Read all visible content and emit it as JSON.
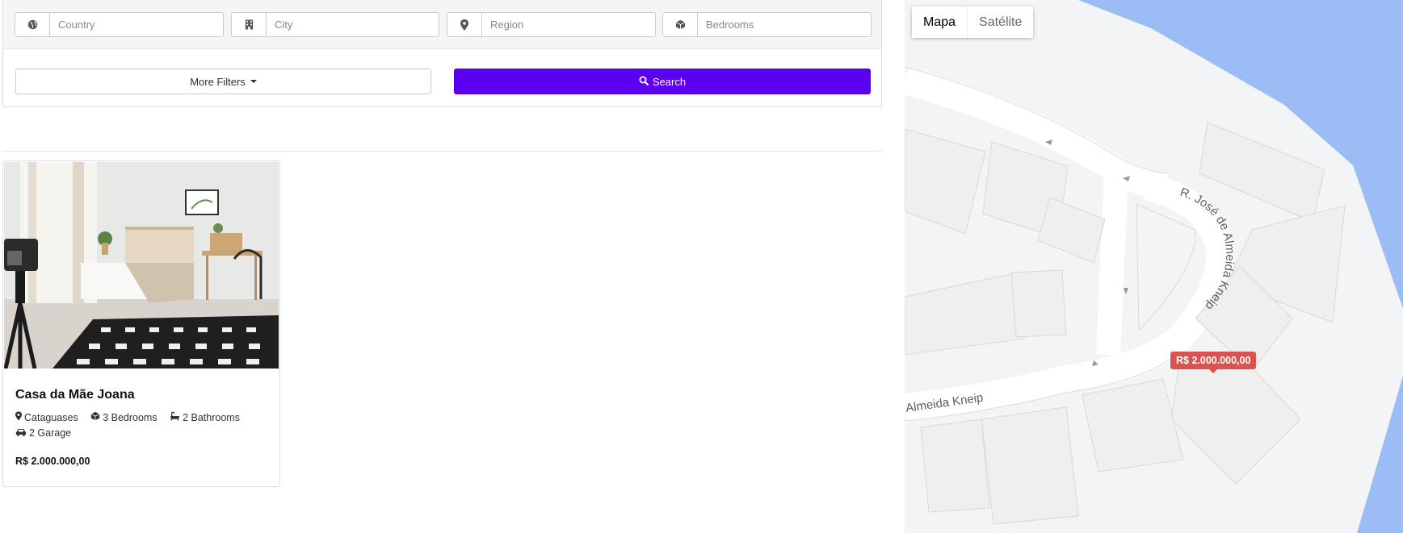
{
  "filters": {
    "country_placeholder": "Country",
    "city_placeholder": "City",
    "region_placeholder": "Region",
    "bedrooms_placeholder": "Bedrooms",
    "more_filters_label": "More Filters",
    "search_label": "Search"
  },
  "listing": {
    "title": "Casa da Mãe Joana",
    "city": "Cataguases",
    "bedrooms": "3 Bedrooms",
    "bathrooms": "2 Bathrooms",
    "garage": "2 Garage",
    "price": "R$ 2.000.000,00"
  },
  "map": {
    "type_map_label": "Mapa",
    "type_satellite_label": "Satélite",
    "street_name_1": "R. José de Almeida Kneip",
    "street_name_2": "Almeida Kneip",
    "marker_price": "R$ 2.000.000,00",
    "water_color": "#9bbcf5"
  }
}
